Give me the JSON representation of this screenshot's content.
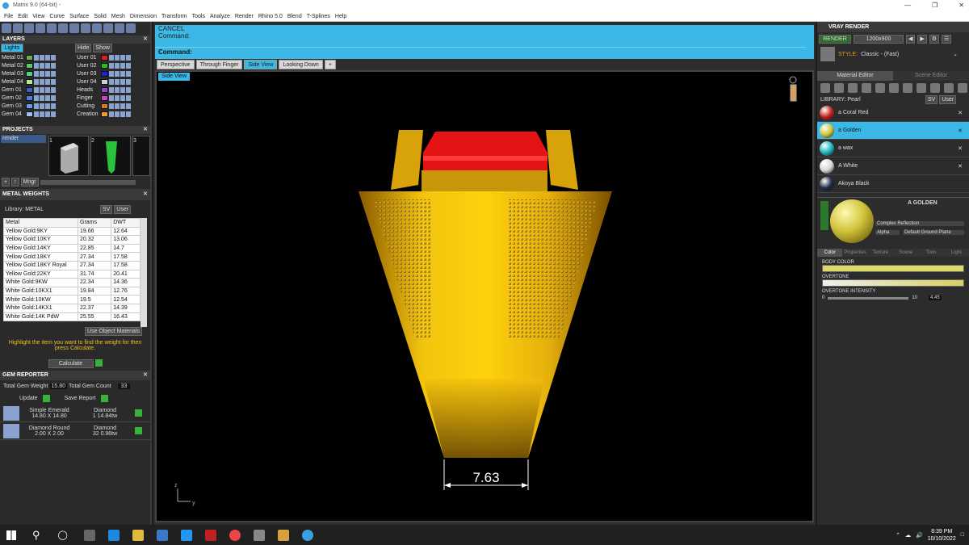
{
  "window": {
    "title": "Matrix 9.0 (64-bit) -"
  },
  "menu": [
    "File",
    "Edit",
    "View",
    "Curve",
    "Surface",
    "Solid",
    "Mesh",
    "Dimension",
    "Transform",
    "Tools",
    "Analyze",
    "Render",
    "Rhino 5.0",
    "Blend",
    "T-Splines",
    "Help"
  ],
  "layers": {
    "title": "LAYERS",
    "lights_label": "Lights",
    "hide_label": "Hide",
    "show_label": "Show",
    "left": [
      {
        "name": "Metal 01",
        "color": "#6ab04c"
      },
      {
        "name": "Metal 02",
        "color": "#56c96b"
      },
      {
        "name": "Metal 03",
        "color": "#4bd28a"
      },
      {
        "name": "Metal 04",
        "color": "#b4e894"
      },
      {
        "name": "Gem 01",
        "color": "#3b5fc9"
      },
      {
        "name": "Gem 02",
        "color": "#4c7de0"
      },
      {
        "name": "Gem 03",
        "color": "#6a9ae8"
      },
      {
        "name": "Gem 04",
        "color": "#9dbcf0"
      }
    ],
    "right": [
      {
        "name": "User 01",
        "color": "#e02020"
      },
      {
        "name": "User 02",
        "color": "#20c020"
      },
      {
        "name": "User 03",
        "color": "#2020e0"
      },
      {
        "name": "User 04",
        "color": "#d0d0d0"
      },
      {
        "name": "Heads",
        "color": "#9a44c8"
      },
      {
        "name": "Finger",
        "color": "#d040d0"
      },
      {
        "name": "Cutting",
        "color": "#e07820"
      },
      {
        "name": "Creation",
        "color": "#e8a030"
      }
    ]
  },
  "projects": {
    "title": "PROJECTS",
    "item": "render",
    "thumbs": [
      "1",
      "2",
      "3"
    ],
    "mngr": "Mngr"
  },
  "metal_weights": {
    "title": "METAL WEIGHTS",
    "library": "Library: METAL",
    "sv": "SV",
    "user": "User",
    "columns": [
      "Metal",
      "Grams",
      "DWT"
    ],
    "rows": [
      [
        "Yellow Gold:9KY",
        "19.66",
        "12.64"
      ],
      [
        "Yellow Gold:10KY",
        "20.32",
        "13.06"
      ],
      [
        "Yellow Gold:14KY",
        "22.85",
        "14.7"
      ],
      [
        "Yellow Gold:18KY",
        "27.34",
        "17.58"
      ],
      [
        "Yellow Gold:18KY Royal",
        "27.34",
        "17.58"
      ],
      [
        "Yellow Gold:22KY",
        "31.74",
        "20.41"
      ],
      [
        "White Gold:9KW",
        "22.34",
        "14.36"
      ],
      [
        "White Gold:10KX1",
        "19.84",
        "12.76"
      ],
      [
        "White Gold:10KW",
        "19.5",
        "12.54"
      ],
      [
        "White Gold:14KX1",
        "22.37",
        "14.39"
      ],
      [
        "White Gold:14K PdW",
        "25.55",
        "16.43"
      ]
    ],
    "use_object": "Use Object Materials",
    "hint": "Highlight the item you want to find the weight for then press Calculate.",
    "calculate": "Calculate"
  },
  "gem_reporter": {
    "title": "GEM REPORTER",
    "total_weight_label": "Total Gem Weight",
    "total_weight": "15.80",
    "total_count_label": "Total Gem Count",
    "total_count": "33",
    "update": "Update",
    "save_report": "Save Report",
    "gems": [
      {
        "name": "Simple Emerald",
        "type": "Diamond",
        "size": "14.80 X 14.80",
        "count": "1",
        "weight": "14.84tw"
      },
      {
        "name": "Diamond Round",
        "type": "Diamond",
        "size": "2.00 X 2.00",
        "count": "32",
        "weight": "0.96tw"
      }
    ]
  },
  "command": {
    "cancel": "CANCEL",
    "prompt": "Command:",
    "label": "Command:"
  },
  "view_tabs": [
    "Perspective",
    "Through Finger",
    "Side View",
    "Looking Down"
  ],
  "active_view": "Side View",
  "viewport": {
    "label": "Side View",
    "dimension": "7.63",
    "axis_z": "z",
    "axis_y": "y"
  },
  "vray": {
    "title": "VRAY RENDER",
    "render": "RENDER",
    "resolution": "1200x900",
    "style_label": "STYLE:",
    "style": "Classic - (Fast)",
    "tabs": [
      "Material Editor",
      "Scene Editor"
    ],
    "library": "LIBRARY: Pearl",
    "materials": [
      {
        "name": "a Coral Red",
        "color": "#c0201c"
      },
      {
        "name": "a Golden",
        "color": "#cfc43a"
      },
      {
        "name": "a wax",
        "color": "#1fb8c0"
      },
      {
        "name": "A White",
        "color": "#d8d8d8"
      },
      {
        "name": "Akoya Black",
        "color": "#1e2c44"
      }
    ],
    "selected": "A GOLDEN",
    "reflection": "Complex Reflection",
    "alpha": "Alpha",
    "ground": "Default Ground Plane",
    "sub_tabs": [
      "Color",
      "Properties",
      "Texture",
      "Scene",
      "Toon",
      "Light"
    ],
    "body_color": "BODY COLOR",
    "overtone": "OVERTONE",
    "overtone_intensity": "OVERTONE INTENSITY",
    "intensity_value": "4.45",
    "intensity_min": "0",
    "intensity_max": "10"
  },
  "taskbar": {
    "time": "8:39 PM",
    "date": "10/10/2022"
  }
}
